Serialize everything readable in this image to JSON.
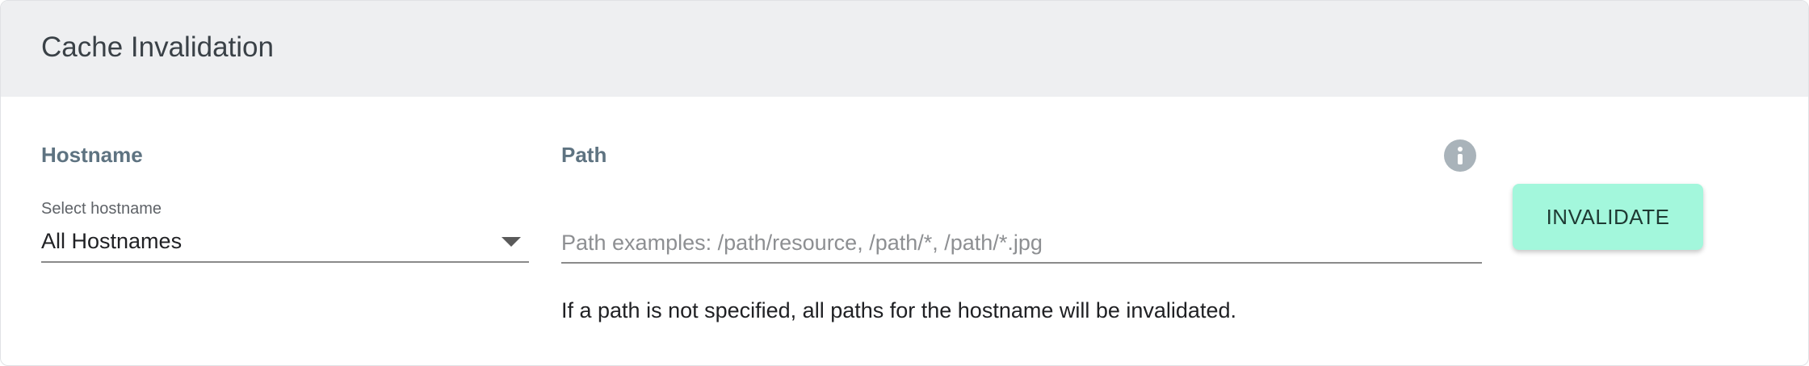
{
  "header": {
    "title": "Cache Invalidation"
  },
  "hostname": {
    "label": "Hostname",
    "select_caption": "Select hostname",
    "selected_value": "All Hostnames"
  },
  "path": {
    "label": "Path",
    "value": "",
    "placeholder": "Path examples: /path/resource, /path/*, /path/*.jpg",
    "helper_text": "If a path is not specified, all paths for the hostname will be invalidated."
  },
  "actions": {
    "invalidate_label": "INVALIDATE"
  },
  "icons": {
    "info": "info-icon",
    "dropdown": "chevron-down-icon"
  },
  "colors": {
    "header_bg": "#eeeff1",
    "label_color": "#5e7381",
    "button_bg": "#a3f7dc",
    "info_icon": "#a9b3ba"
  }
}
